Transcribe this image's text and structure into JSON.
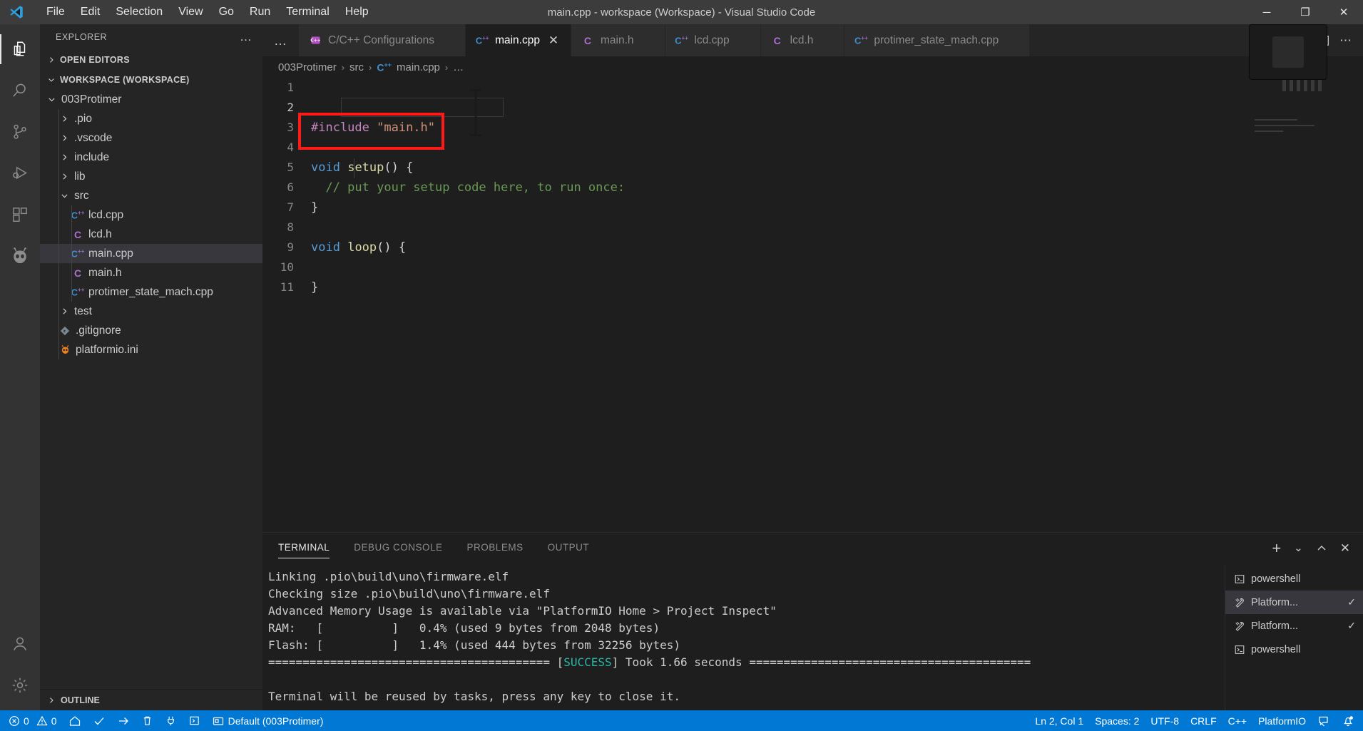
{
  "window": {
    "title": "main.cpp - workspace (Workspace) - Visual Studio Code",
    "minimize": "─",
    "maximize": "❐",
    "close": "✕"
  },
  "menubar": [
    "File",
    "Edit",
    "Selection",
    "View",
    "Go",
    "Run",
    "Terminal",
    "Help"
  ],
  "activitybar": {
    "items": [
      {
        "name": "explorer-icon",
        "title": "Explorer",
        "active": true
      },
      {
        "name": "search-icon",
        "title": "Search",
        "active": false
      },
      {
        "name": "source-control-icon",
        "title": "Source Control",
        "active": false
      },
      {
        "name": "run-and-debug-icon",
        "title": "Run and Debug",
        "active": false
      },
      {
        "name": "extensions-icon",
        "title": "Extensions",
        "active": false
      },
      {
        "name": "platformio-alien-icon",
        "title": "PlatformIO",
        "active": false
      }
    ],
    "bottom": [
      {
        "name": "accounts-icon",
        "title": "Accounts"
      },
      {
        "name": "settings-gear-icon",
        "title": "Manage"
      }
    ]
  },
  "sidebar": {
    "header": "EXPLORER",
    "more_label": "…",
    "sections": {
      "open_editors": "OPEN EDITORS",
      "workspace": "WORKSPACE (WORKSPACE)",
      "outline": "OUTLINE"
    },
    "tree": [
      {
        "label": "003Protimer",
        "type": "folder",
        "expanded": true,
        "depth": 1,
        "selected": false
      },
      {
        "label": ".pio",
        "type": "folder",
        "expanded": false,
        "depth": 2,
        "selected": false
      },
      {
        "label": ".vscode",
        "type": "folder",
        "expanded": false,
        "depth": 2,
        "selected": false
      },
      {
        "label": "include",
        "type": "folder",
        "expanded": false,
        "depth": 2,
        "selected": false
      },
      {
        "label": "lib",
        "type": "folder",
        "expanded": false,
        "depth": 2,
        "selected": false
      },
      {
        "label": "src",
        "type": "folder",
        "expanded": true,
        "depth": 2,
        "selected": false
      },
      {
        "label": "lcd.cpp",
        "type": "cpp",
        "depth": 3,
        "selected": false
      },
      {
        "label": "lcd.h",
        "type": "h",
        "depth": 3,
        "selected": false
      },
      {
        "label": "main.cpp",
        "type": "cpp",
        "depth": 3,
        "selected": true
      },
      {
        "label": "main.h",
        "type": "h",
        "depth": 3,
        "selected": false
      },
      {
        "label": "protimer_state_mach.cpp",
        "type": "cpp",
        "depth": 3,
        "selected": false
      },
      {
        "label": "test",
        "type": "folder",
        "expanded": false,
        "depth": 2,
        "selected": false
      },
      {
        "label": ".gitignore",
        "type": "git",
        "depth": 2,
        "selected": false
      },
      {
        "label": "platformio.ini",
        "type": "pio",
        "depth": 2,
        "selected": false
      }
    ]
  },
  "editor": {
    "tabs": [
      {
        "label": "C/C++ Configurations",
        "icon": "cpp-config-icon",
        "active": false,
        "dirty": false
      },
      {
        "label": "main.cpp",
        "icon": "cpp-icon",
        "active": true,
        "dirty": false
      },
      {
        "label": "main.h",
        "icon": "h-icon",
        "active": false,
        "dirty": false
      },
      {
        "label": "lcd.cpp",
        "icon": "cpp-icon",
        "active": false,
        "dirty": false
      },
      {
        "label": "lcd.h",
        "icon": "h-icon",
        "active": false,
        "dirty": false
      },
      {
        "label": "protimer_state_mach.cpp",
        "icon": "cpp-icon",
        "active": false,
        "dirty": false
      }
    ],
    "tab_close_glyph": "✕",
    "tabs_overflow": "…",
    "breadcrumb": [
      "003Protimer",
      "src",
      "main.cpp",
      "…"
    ],
    "breadcrumb_separator": "›",
    "line_numbers": [
      "1",
      "2",
      "3",
      "4",
      "5",
      "6",
      "7",
      "8",
      "9",
      "10",
      "11"
    ],
    "current_line": 2,
    "code_lines": [
      {
        "n": 1,
        "tokens": []
      },
      {
        "n": 2,
        "tokens": []
      },
      {
        "n": 3,
        "tokens": [
          {
            "t": "#include ",
            "c": "pre"
          },
          {
            "t": "\"main.h\"",
            "c": "str"
          }
        ]
      },
      {
        "n": 4,
        "tokens": []
      },
      {
        "n": 5,
        "tokens": [
          {
            "t": "void",
            "c": "key"
          },
          {
            "t": " ",
            "c": "pun"
          },
          {
            "t": "setup",
            "c": "fn"
          },
          {
            "t": "() {",
            "c": "pun"
          }
        ]
      },
      {
        "n": 6,
        "tokens": [
          {
            "t": "  // put your setup code here, to run once:",
            "c": "com"
          }
        ]
      },
      {
        "n": 7,
        "tokens": [
          {
            "t": "}",
            "c": "pun"
          }
        ]
      },
      {
        "n": 8,
        "tokens": []
      },
      {
        "n": 9,
        "tokens": [
          {
            "t": "void",
            "c": "key"
          },
          {
            "t": " ",
            "c": "pun"
          },
          {
            "t": "loop",
            "c": "fn"
          },
          {
            "t": "() {",
            "c": "pun"
          }
        ]
      },
      {
        "n": 10,
        "tokens": []
      },
      {
        "n": 11,
        "tokens": [
          {
            "t": "}",
            "c": "pun"
          }
        ]
      }
    ],
    "annotation_color": "#ff1a1a"
  },
  "panel": {
    "tabs": [
      "TERMINAL",
      "DEBUG CONSOLE",
      "PROBLEMS",
      "OUTPUT"
    ],
    "active_tab": "TERMINAL",
    "actions": {
      "new": "+",
      "split_chevron": "⌄",
      "collapse": "⌃",
      "close": "✕"
    },
    "terminal_lines": [
      {
        "text": "Linking .pio\\build\\uno\\firmware.elf"
      },
      {
        "text": "Checking size .pio\\build\\uno\\firmware.elf"
      },
      {
        "text": "Advanced Memory Usage is available via \"PlatformIO Home > Project Inspect\""
      },
      {
        "text": "RAM:   [          ]   0.4% (used 9 bytes from 2048 bytes)"
      },
      {
        "text": "Flash: [          ]   1.4% (used 444 bytes from 32256 bytes)"
      },
      {
        "pre": "========================================= [",
        "ok": "SUCCESS",
        "post": "] Took 1.66 seconds ========================================="
      },
      {
        "text": ""
      },
      {
        "text": "Terminal will be reused by tasks, press any key to close it."
      }
    ],
    "terminal_list": [
      {
        "label": "powershell",
        "icon": "terminal-icon",
        "active": false,
        "check": ""
      },
      {
        "label": "Platform...",
        "icon": "tools-icon",
        "active": true,
        "check": "✓"
      },
      {
        "label": "Platform...",
        "icon": "tools-icon",
        "active": false,
        "check": "✓"
      },
      {
        "label": "powershell",
        "icon": "terminal-icon",
        "active": false,
        "check": ""
      }
    ]
  },
  "statusbar": {
    "left": [
      {
        "name": "remote-indicator",
        "icon": "error-circle-icon",
        "label": "0",
        "second_icon": "warning-triangle-icon",
        "second_label": "0"
      },
      {
        "name": "pio-home",
        "icon": "home-icon",
        "label": ""
      },
      {
        "name": "pio-build",
        "icon": "check-icon",
        "label": ""
      },
      {
        "name": "pio-upload",
        "icon": "arrow-right-icon",
        "label": ""
      },
      {
        "name": "pio-clean",
        "icon": "trash-icon",
        "label": ""
      },
      {
        "name": "pio-serial-monitor",
        "icon": "plug-icon",
        "label": ""
      },
      {
        "name": "pio-new-terminal",
        "icon": "terminal-square-icon",
        "label": ""
      },
      {
        "name": "pio-project-env",
        "icon": "folder-env-icon",
        "label": "Default (003Protimer)"
      }
    ],
    "right": [
      {
        "name": "editor-position",
        "label": "Ln 2, Col 1"
      },
      {
        "name": "editor-indentation",
        "label": "Spaces: 2"
      },
      {
        "name": "editor-encoding",
        "label": "UTF-8"
      },
      {
        "name": "editor-eol",
        "label": "CRLF"
      },
      {
        "name": "editor-language",
        "label": "C++"
      },
      {
        "name": "platformio-status",
        "label": "PlatformIO"
      },
      {
        "name": "feedback-icon",
        "label": ""
      },
      {
        "name": "notifications-bell-icon",
        "label": ""
      }
    ],
    "accent_color": "#0078d4"
  },
  "overlay": {
    "recorder_label": ""
  }
}
